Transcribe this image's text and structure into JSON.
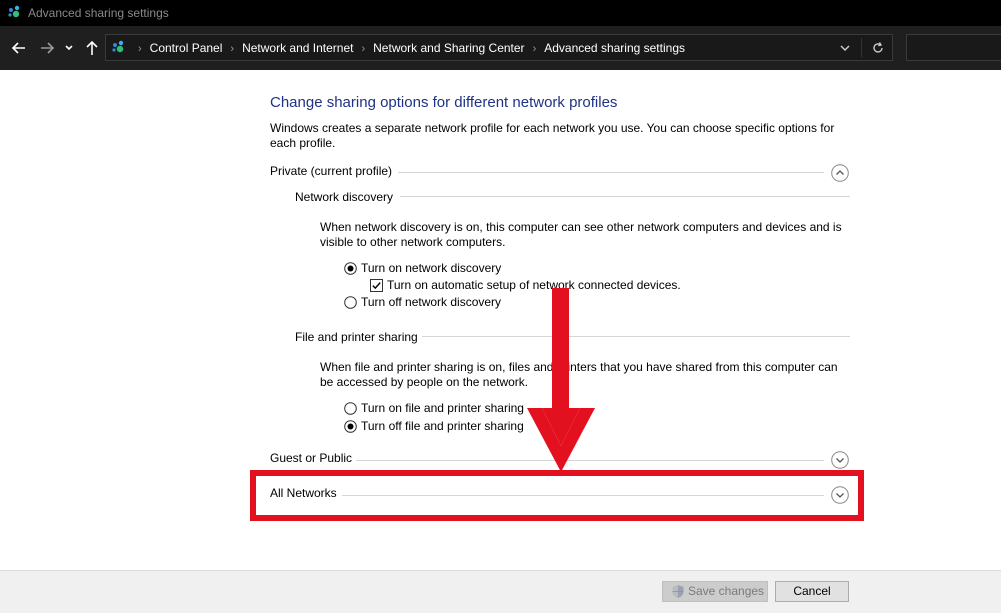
{
  "window": {
    "title": "Advanced sharing settings"
  },
  "address_bar": {
    "breadcrumbs": [
      "Control Panel",
      "Network and Internet",
      "Network and Sharing Center",
      "Advanced sharing settings"
    ],
    "search_placeholder": ""
  },
  "content": {
    "heading": "Change sharing options for different network profiles",
    "intro": "Windows creates a separate network profile for each network you use. You can choose specific options for each profile.",
    "profiles": {
      "private": {
        "label": "Private (current profile)",
        "expanded": true
      },
      "guest": {
        "label": "Guest or Public",
        "expanded": false
      },
      "all": {
        "label": "All Networks",
        "expanded": false
      }
    },
    "network_discovery": {
      "title": "Network discovery",
      "description": "When network discovery is on, this computer can see other network computers and devices and is visible to other network computers.",
      "on_label": "Turn on network discovery",
      "auto_setup_label": "Turn on automatic setup of network connected devices.",
      "off_label": "Turn off network discovery",
      "selected": "on",
      "auto_setup_checked": true
    },
    "file_printer_sharing": {
      "title": "File and printer sharing",
      "description": "When file and printer sharing is on, files and printers that you have shared from this computer can be accessed by people on the network.",
      "on_label": "Turn on file and printer sharing",
      "off_label": "Turn off file and printer sharing",
      "selected": "off"
    }
  },
  "footer": {
    "save_label": "Save changes",
    "cancel_label": "Cancel",
    "save_enabled": false
  },
  "colors": {
    "heading": "#1e3287",
    "highlight": "#e3111f",
    "titlebar": "#000000",
    "navbar": "#1f1f1f"
  },
  "icons": {
    "window": "network-icon",
    "back": "arrow-left-icon",
    "forward": "arrow-right-icon",
    "recent": "chevron-down-icon",
    "up": "arrow-up-icon",
    "refresh": "refresh-icon",
    "save": "uac-shield-icon"
  }
}
